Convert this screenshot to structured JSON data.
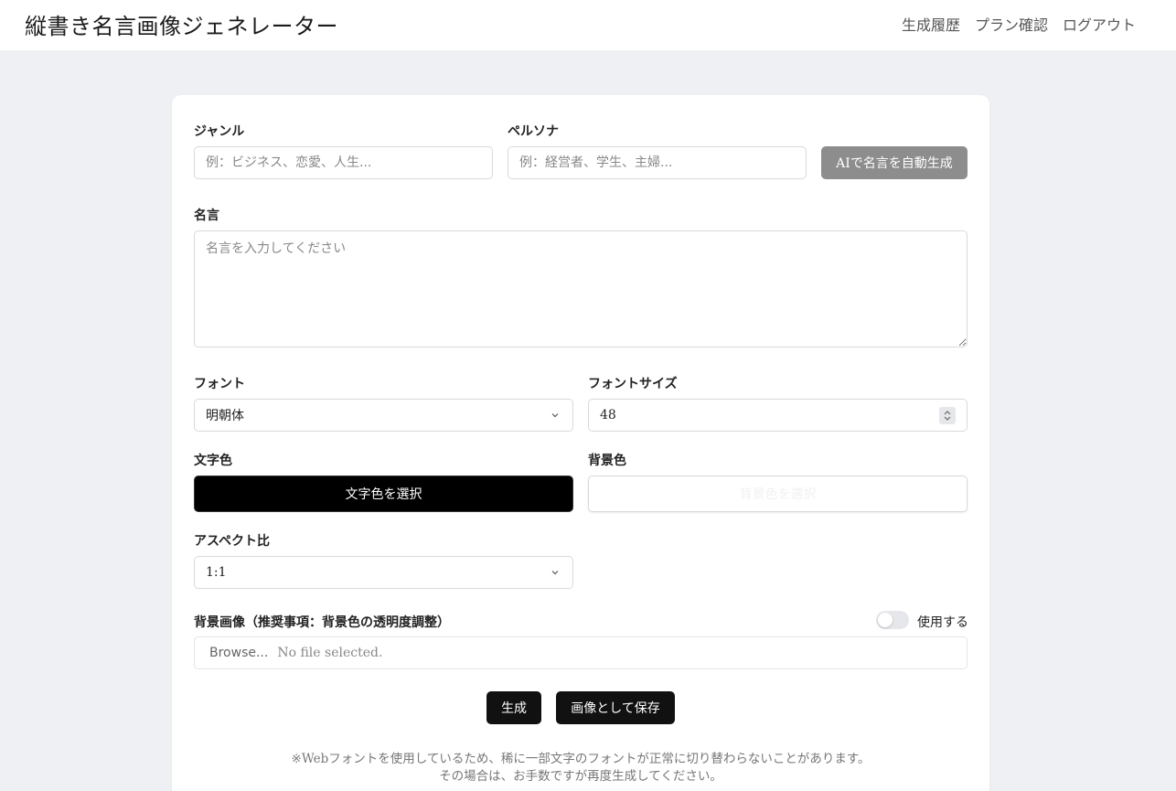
{
  "header": {
    "title": "縦書き名言画像ジェネレーター",
    "nav": [
      "生成履歴",
      "プラン確認",
      "ログアウト"
    ]
  },
  "form": {
    "genre": {
      "label": "ジャンル",
      "placeholder": "例：ビジネス、恋愛、人生..."
    },
    "persona": {
      "label": "ペルソナ",
      "placeholder": "例：経営者、学生、主婦..."
    },
    "ai_button": "AIで名言を自動生成",
    "quote": {
      "label": "名言",
      "placeholder": "名言を入力してください"
    },
    "font": {
      "label": "フォント",
      "value": "明朝体"
    },
    "font_size": {
      "label": "フォントサイズ",
      "value": "48"
    },
    "text_color": {
      "label": "文字色",
      "button": "文字色を選択",
      "color": "#000000"
    },
    "bg_color": {
      "label": "背景色",
      "button": "背景色を選択",
      "color": "#ffffff"
    },
    "aspect": {
      "label": "アスペクト比",
      "value": "1:1"
    },
    "bg_image": {
      "label": "背景画像（推奨事項：背景色の透明度調整）",
      "toggle_label": "使用する",
      "toggle_on": false,
      "browse": "Browse...",
      "file_status": "No file selected."
    },
    "generate_button": "生成",
    "save_button": "画像として保存",
    "note_line1": "※Webフォントを使用しているため、稀に一部文字のフォントが正常に切り替わらないことがあります。",
    "note_line2": "その場合は、お手数ですが再度生成してください。"
  },
  "colors": {
    "page_bg": "#eef0f3",
    "button_dark": "#111111",
    "button_disabled": "#8d8d8d"
  }
}
